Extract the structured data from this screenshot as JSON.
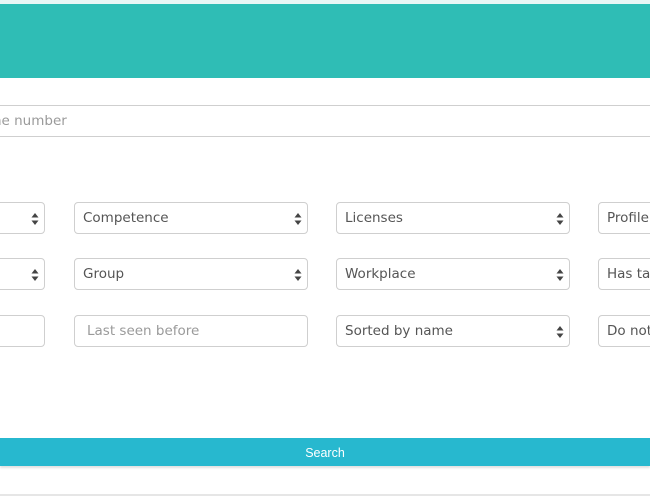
{
  "header": {
    "color": "#2fbdb5"
  },
  "phone_field": {
    "placeholder": "Phone number"
  },
  "filters": {
    "row1": {
      "col0": "",
      "competence": "Competence",
      "licenses": "Licenses",
      "profile": "Profile"
    },
    "row2": {
      "col0": "",
      "group": "Group",
      "workplace": "Workplace",
      "has_tag": "Has tag"
    },
    "row3": {
      "col0": "",
      "last_seen_before_placeholder": "Last seen before",
      "sort": "Sorted by name",
      "do_not": "Do not"
    }
  },
  "search_button": {
    "label": "Search",
    "color": "#27b8cf"
  },
  "icons": [
    "sort-arrows-icon"
  ]
}
